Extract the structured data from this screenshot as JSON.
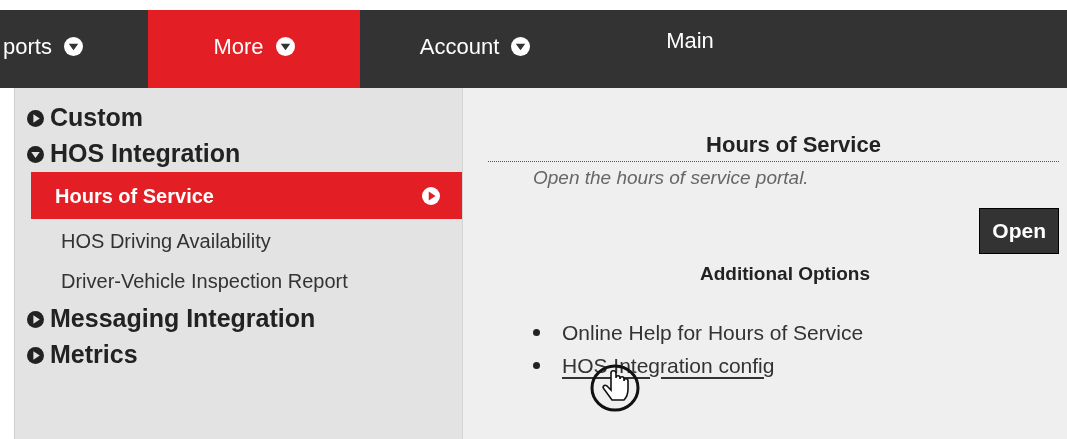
{
  "nav": {
    "tabs": [
      {
        "label": "ports",
        "selected": false,
        "caret": true
      },
      {
        "label": "More",
        "selected": true,
        "caret": true
      },
      {
        "label": "Account",
        "selected": false,
        "caret": true
      },
      {
        "label": "Main",
        "selected": false,
        "caret": false
      }
    ]
  },
  "menu": {
    "items": [
      {
        "label": "Custom",
        "expanded": false
      },
      {
        "label": "HOS Integration",
        "expanded": true,
        "children": [
          {
            "label": "Hours of Service",
            "selected": true
          },
          {
            "label": "HOS Driving Availability",
            "selected": false
          },
          {
            "label": "Driver-Vehicle Inspection Report",
            "selected": false
          }
        ]
      },
      {
        "label": "Messaging Integration",
        "expanded": false
      },
      {
        "label": "Metrics",
        "expanded": false
      }
    ]
  },
  "detail": {
    "title": "Hours of Service",
    "description": "Open the hours of service portal.",
    "open_button": "Open",
    "options_heading": "Additional Options",
    "options": [
      {
        "label": "Online Help for Hours of Service",
        "hovered": false
      },
      {
        "label": "HOS Integration config",
        "hovered": true
      }
    ]
  }
}
